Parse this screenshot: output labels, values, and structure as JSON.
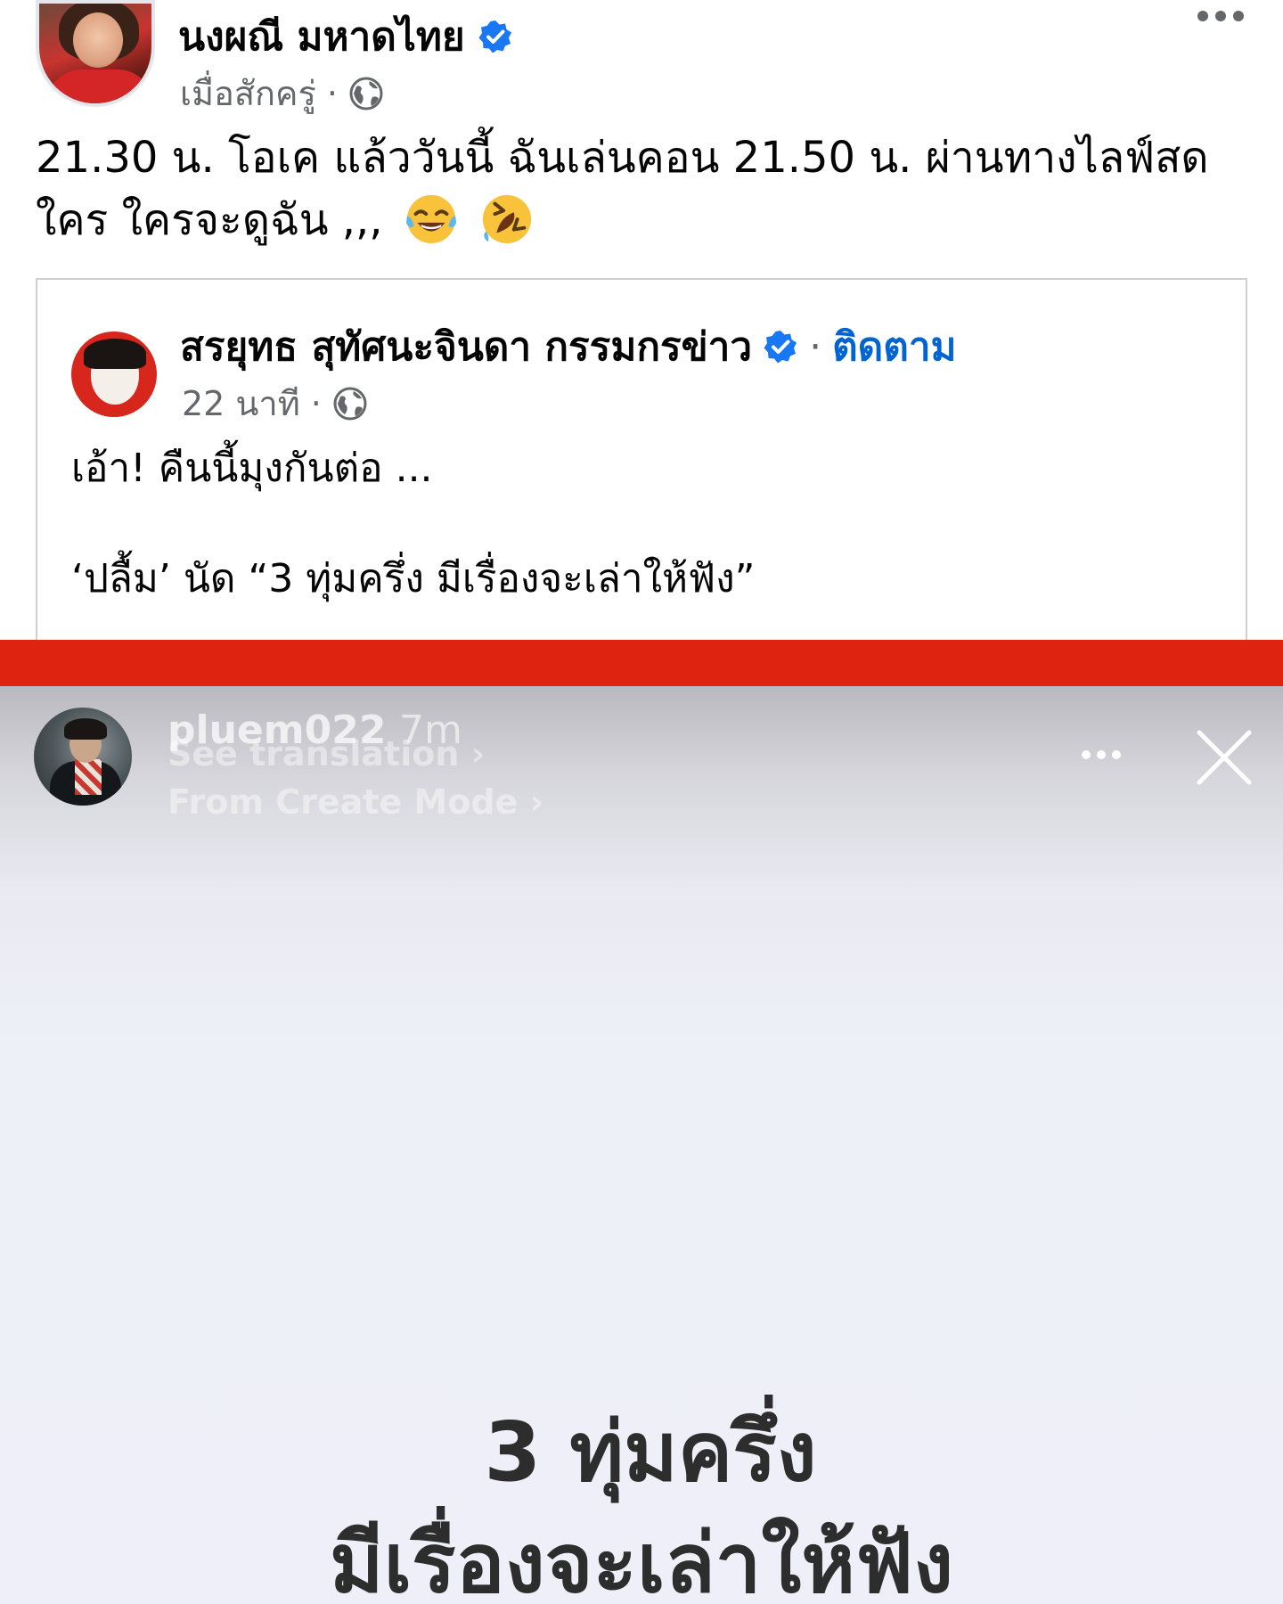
{
  "post": {
    "author": "นงผณี มหาดไทย",
    "time": "เมื่อสักครู่",
    "separator": "·",
    "text": "21.30 น. โอเค แล้ววันนี้ ฉันเล่นคอน 21.50 น. ผ่านทางไลฟ์สด ใคร ใครจะดูฉัน ,,,",
    "emojis": [
      "face-with-tears-of-joy",
      "rolling-on-floor-laughing"
    ]
  },
  "shared": {
    "author": "สรยุทธ สุทัศนะจินดา กรรมกรข่าว",
    "separator": "·",
    "follow_label": "ติดตาม",
    "time": "22 นาที",
    "line1": "เอ้า! คืนนี้มุงกันต่อ ...",
    "line2": "‘ปลื้ม’ นัด “3 ทุ่มครึ่ง มีเรื่องจะเล่าให้ฟัง”"
  },
  "story": {
    "username": "pluem022",
    "time": "7m",
    "see_translation": "See translation ›",
    "from_create_mode": "From Create Mode ›",
    "caption_line1": "3 ทุ่มครึ่ง",
    "caption_line2": "มีเรื่องจะเล่าให้ฟัง"
  },
  "colors": {
    "divider": "#de2310",
    "link_blue": "#0064d1",
    "verified_blue": "#1877f2",
    "meta_gray": "#65676b"
  },
  "icons": [
    "verified-badge-icon",
    "globe-icon",
    "more-options-icon",
    "close-icon"
  ]
}
